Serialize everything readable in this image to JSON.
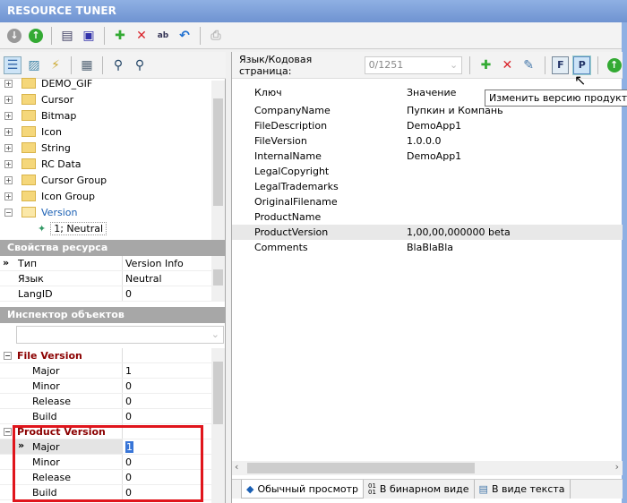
{
  "app": {
    "title": "RESOURCE TUNER"
  },
  "tree": {
    "items": [
      {
        "label": "DEMO_GIF"
      },
      {
        "label": "Cursor"
      },
      {
        "label": "Bitmap"
      },
      {
        "label": "Icon"
      },
      {
        "label": "String"
      },
      {
        "label": "RC Data"
      },
      {
        "label": "Cursor Group"
      },
      {
        "label": "Icon Group"
      },
      {
        "label": "Version"
      }
    ],
    "child": "1; Neutral"
  },
  "resource_props": {
    "title": "Свойства ресурса",
    "rows": [
      {
        "key": "Тип",
        "value": "Version Info"
      },
      {
        "key": "Язык",
        "value": "Neutral"
      },
      {
        "key": "LangID",
        "value": "0"
      }
    ]
  },
  "inspector": {
    "title": "Инспектор объектов",
    "combo_value": "",
    "groups": [
      {
        "name": "File Version",
        "rows": [
          {
            "key": "Major",
            "value": "1"
          },
          {
            "key": "Minor",
            "value": "0"
          },
          {
            "key": "Release",
            "value": "0"
          },
          {
            "key": "Build",
            "value": "0"
          }
        ]
      },
      {
        "name": "Product Version",
        "rows": [
          {
            "key": "Major",
            "value": "1"
          },
          {
            "key": "Minor",
            "value": "0"
          },
          {
            "key": "Release",
            "value": "0"
          },
          {
            "key": "Build",
            "value": "0"
          }
        ]
      }
    ]
  },
  "right": {
    "lang_label": "Язык/Кодовая страница:",
    "lang_value": "0/1251",
    "tooltip": "Изменить версию продукта",
    "headers": {
      "key": "Ключ",
      "value": "Значение"
    },
    "rows": [
      {
        "key": "CompanyName",
        "value": "Пупкин и Компань"
      },
      {
        "key": "FileDescription",
        "value": "DemoApp1"
      },
      {
        "key": "FileVersion",
        "value": "1.0.0.0"
      },
      {
        "key": "InternalName",
        "value": "DemoApp1"
      },
      {
        "key": "LegalCopyright",
        "value": ""
      },
      {
        "key": "LegalTrademarks",
        "value": ""
      },
      {
        "key": "OriginalFilename",
        "value": ""
      },
      {
        "key": "ProductName",
        "value": ""
      },
      {
        "key": "ProductVersion",
        "value": "1,00,00,000000 beta"
      },
      {
        "key": "Comments",
        "value": "BlaBlaBla"
      }
    ],
    "tabs": [
      {
        "label": "Обычный просмотр"
      },
      {
        "label": "В бинарном виде"
      },
      {
        "label": "В виде текста"
      }
    ]
  },
  "colors": {
    "title": "#6f93d1",
    "accent_red": "#d9232a",
    "group_red": "#8b0000"
  }
}
